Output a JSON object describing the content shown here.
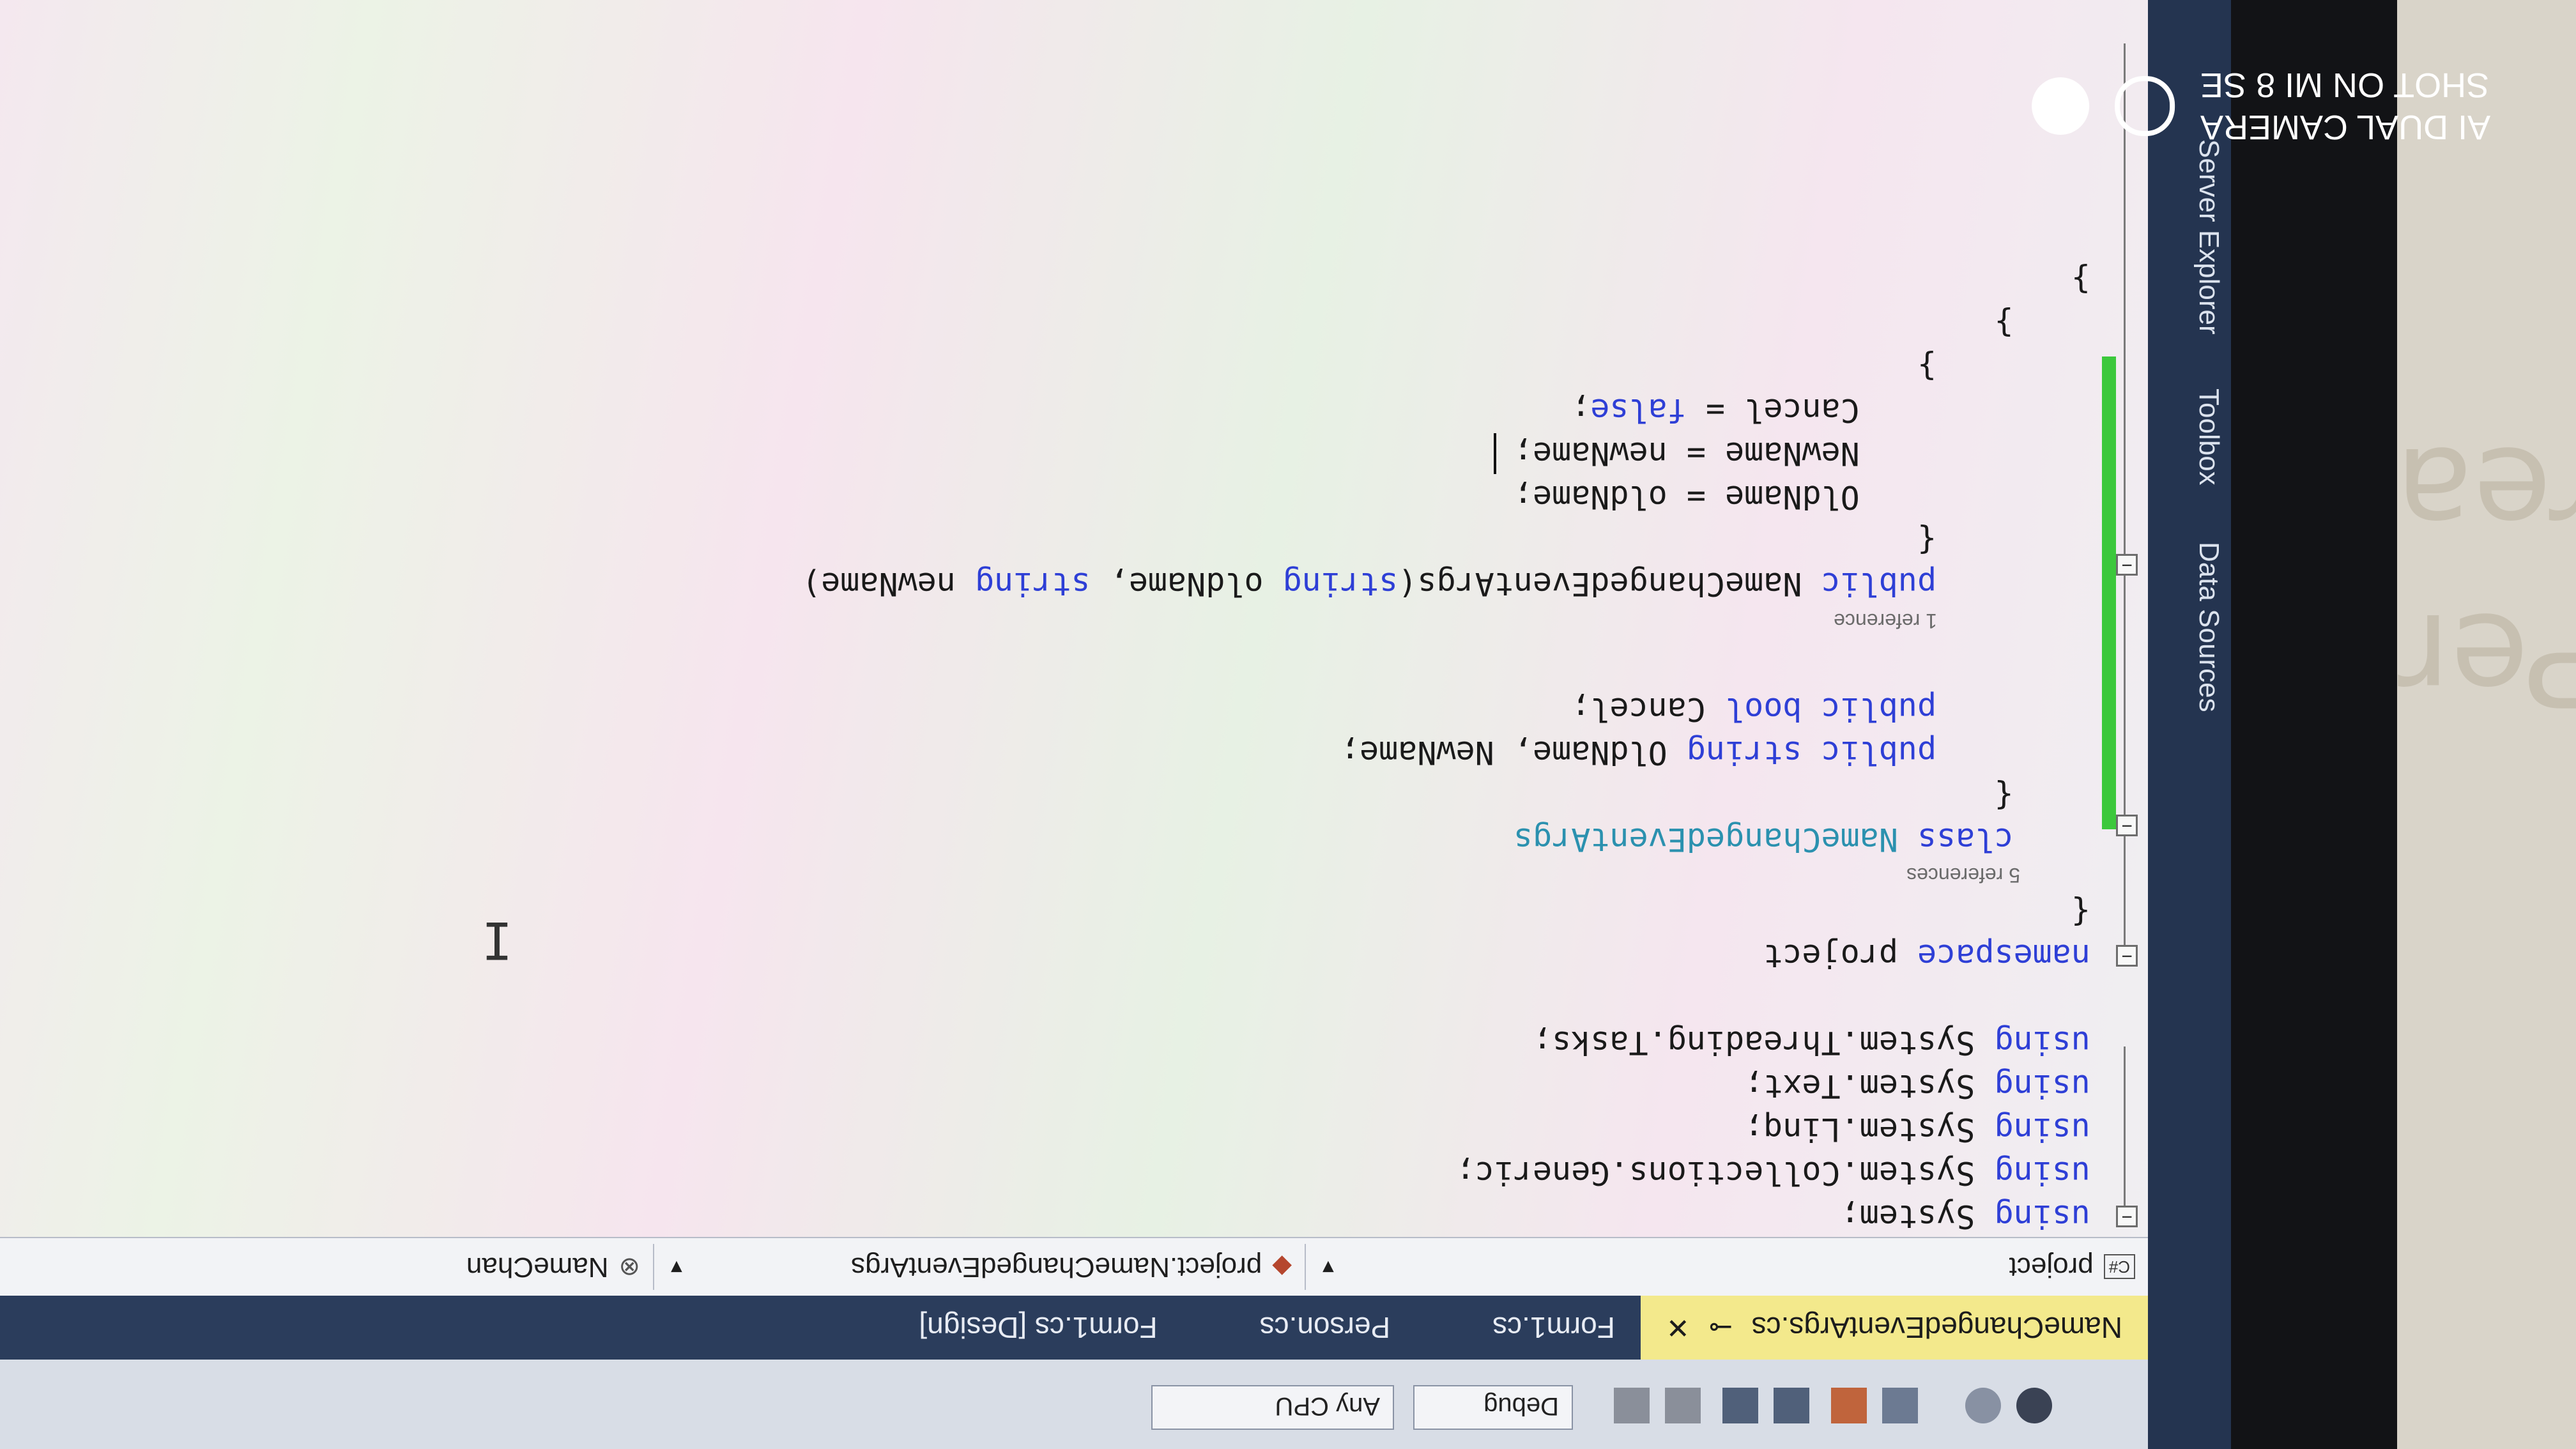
{
  "watermark": {
    "line1": "SHOT ON MI 8 SE",
    "line2": "AI DUAL CAMERA"
  },
  "background_words": [
    "Pers",
    "rea"
  ],
  "side_panel": {
    "items": [
      "Server Explorer",
      "Toolbox",
      "Data Sources"
    ]
  },
  "toolbar": {
    "config": "Debug",
    "platform": "Any CPU"
  },
  "tabs": {
    "items": [
      {
        "label": "NameChangedEventArgs.cs",
        "active": true
      },
      {
        "label": "Form1.cs",
        "active": false
      },
      {
        "label": "Person.cs",
        "active": false
      },
      {
        "label": "Form1.cs [Design]",
        "active": false
      }
    ],
    "pin_icon": "⊸",
    "close_icon": "✕"
  },
  "navbar": {
    "project": "project",
    "project_badge": "C#",
    "class_path": "project.NameChangedEventArgs",
    "member": "NameChan"
  },
  "code": {
    "lines": [
      "using System;",
      "using System.Collections.Generic;",
      "using System.Linq;",
      "using System.Text;",
      "using System.Threading.Tasks;",
      "",
      "namespace project",
      "{",
      "    class NameChangedEventArgs",
      "    {",
      "        public string OldName, NewName;",
      "        public bool Cancel;",
      "",
      "        public NameChangedEventArgs(string oldName, string newName)",
      "        {",
      "            OldName = oldName;",
      "            NewName = newName;",
      "            Cancel = false;",
      "        }",
      "    }",
      "}"
    ],
    "lens_class": "5 references",
    "lens_ctor": "1 reference"
  },
  "colors": {
    "keyword": "#2e3fd6",
    "type": "#2b91af",
    "active_tab": "#f3e98c",
    "change_bar": "#3cc83c"
  }
}
